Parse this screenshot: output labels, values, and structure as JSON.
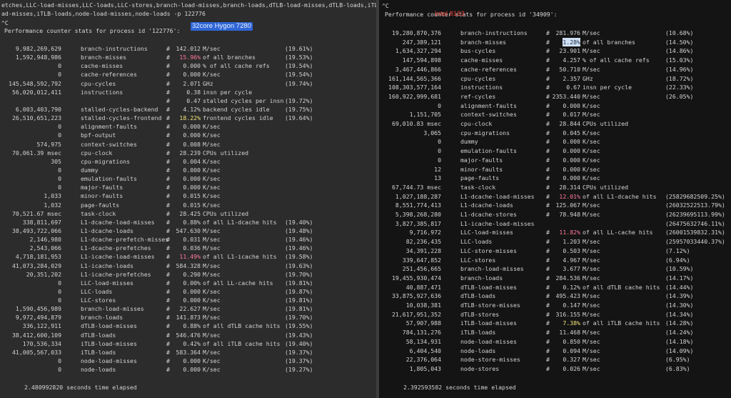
{
  "left": {
    "cmd_lines": [
      "etches,LLC-load-misses,LLC-loads,LLC-stores,branch-load-misses,branch-loads,dTLB-load-misses,dTLB-loads,iTLB-lo",
      "ad-misses,iTLB-loads,node-load-misses,node-loads -p 122776"
    ],
    "interrupt": "^C",
    "header": "Performance counter stats for process id '122776':",
    "badge": "32core Hygon 7280",
    "rows": [
      {
        "value": "9,982,269,629",
        "event": "branch-instructions",
        "hash": "#",
        "metric": "142.012",
        "desc": "M/sec",
        "pct": "(19.61%)"
      },
      {
        "value": "1,592,948,986",
        "event": "branch-misses",
        "hash": "#",
        "metric": "15.96%",
        "desc": "of all branches",
        "pct": "(19.53%)",
        "hl": "red"
      },
      {
        "value": "0",
        "event": "cache-misses",
        "hash": "#",
        "metric": "0.000",
        "desc": "% of all cache refs",
        "pct": "(19.54%)"
      },
      {
        "value": "0",
        "event": "cache-references",
        "hash": "#",
        "metric": "0.000",
        "desc": "K/sec",
        "pct": "(19.54%)"
      },
      {
        "value": "145,548,592,792",
        "event": "cpu-cycles",
        "hash": "#",
        "metric": "2.071",
        "desc": "GHz",
        "pct": "(19.74%)"
      },
      {
        "value": "56,020,012,411",
        "event": "instructions",
        "hash": "#",
        "metric": "0.38",
        "desc": "insn per cycle",
        "pct": ""
      },
      {
        "value": "",
        "event": "",
        "hash": "#",
        "metric": "0.47",
        "desc": "stalled cycles per insn",
        "pct": "(19.72%)"
      },
      {
        "value": "6,003,403,790",
        "event": "stalled-cycles-backend",
        "hash": "#",
        "metric": "4.12%",
        "desc": "backend cycles idle",
        "pct": "(19.75%)"
      },
      {
        "value": "26,510,651,223",
        "event": "stalled-cycles-frontend",
        "hash": "#",
        "metric": "18.22%",
        "desc": "frontend cycles idle",
        "pct": "(19.64%)",
        "hl": "yel"
      },
      {
        "value": "0",
        "event": "alignment-faults",
        "hash": "#",
        "metric": "0.000",
        "desc": "K/sec",
        "pct": ""
      },
      {
        "value": "0",
        "event": "bpf-output",
        "hash": "#",
        "metric": "0.000",
        "desc": "K/sec",
        "pct": ""
      },
      {
        "value": "574,975",
        "event": "context-switches",
        "hash": "#",
        "metric": "0.008",
        "desc": "M/sec",
        "pct": ""
      },
      {
        "value": "70,061.39 msec",
        "event": "cpu-clock",
        "hash": "#",
        "metric": "28.239",
        "desc": "CPUs utilized",
        "pct": ""
      },
      {
        "value": "305",
        "event": "cpu-migrations",
        "hash": "#",
        "metric": "0.004",
        "desc": "K/sec",
        "pct": ""
      },
      {
        "value": "0",
        "event": "dummy",
        "hash": "#",
        "metric": "0.000",
        "desc": "K/sec",
        "pct": ""
      },
      {
        "value": "0",
        "event": "emulation-faults",
        "hash": "#",
        "metric": "0.000",
        "desc": "K/sec",
        "pct": ""
      },
      {
        "value": "0",
        "event": "major-faults",
        "hash": "#",
        "metric": "0.000",
        "desc": "K/sec",
        "pct": ""
      },
      {
        "value": "1,033",
        "event": "minor-faults",
        "hash": "#",
        "metric": "0.015",
        "desc": "K/sec",
        "pct": ""
      },
      {
        "value": "1,032",
        "event": "page-faults",
        "hash": "#",
        "metric": "0.015",
        "desc": "K/sec",
        "pct": ""
      },
      {
        "value": "70,521.67 msec",
        "event": "task-clock",
        "hash": "#",
        "metric": "28.425",
        "desc": "CPUs utilized",
        "pct": ""
      },
      {
        "value": "338,811,697",
        "event": "L1-dcache-load-misses",
        "hash": "#",
        "metric": "0.88%",
        "desc": "of all L1-dcache hits",
        "pct": "(19.40%)"
      },
      {
        "value": "38,493,722,066",
        "event": "L1-dcache-loads",
        "hash": "#",
        "metric": "547.630",
        "desc": "M/sec",
        "pct": "(19.48%)"
      },
      {
        "value": "2,146,980",
        "event": "L1-dcache-prefetch-misses",
        "hash": "#",
        "metric": "0.031",
        "desc": "M/sec",
        "pct": "(19.46%)"
      },
      {
        "value": "2,543,066",
        "event": "L1-dcache-prefetches",
        "hash": "#",
        "metric": "0.036",
        "desc": "M/sec",
        "pct": "(19.46%)"
      },
      {
        "value": "4,718,181,953",
        "event": "L1-icache-load-misses",
        "hash": "#",
        "metric": "11.49%",
        "desc": "of all L1-icache hits",
        "pct": "(19.58%)",
        "hl": "red"
      },
      {
        "value": "41,073,284,029",
        "event": "L1-icache-loads",
        "hash": "#",
        "metric": "584.328",
        "desc": "M/sec",
        "pct": "(19.63%)"
      },
      {
        "value": "20,351,202",
        "event": "L1-icache-prefetches",
        "hash": "#",
        "metric": "0.290",
        "desc": "M/sec",
        "pct": "(19.70%)"
      },
      {
        "value": "0",
        "event": "LLC-load-misses",
        "hash": "#",
        "metric": "0.00%",
        "desc": "of all LL-cache hits",
        "pct": "(19.81%)"
      },
      {
        "value": "0",
        "event": "LLC-loads",
        "hash": "#",
        "metric": "0.000",
        "desc": "K/sec",
        "pct": "(19.87%)"
      },
      {
        "value": "0",
        "event": "LLC-stores",
        "hash": "#",
        "metric": "0.000",
        "desc": "K/sec",
        "pct": "(19.81%)"
      },
      {
        "value": "1,590,456,989",
        "event": "branch-load-misses",
        "hash": "#",
        "metric": "22.627",
        "desc": "M/sec",
        "pct": "(19.81%)"
      },
      {
        "value": "9,972,494,879",
        "event": "branch-loads",
        "hash": "#",
        "metric": "141.873",
        "desc": "M/sec",
        "pct": "(19.70%)"
      },
      {
        "value": "336,122,911",
        "event": "dTLB-load-misses",
        "hash": "#",
        "metric": "0.88%",
        "desc": "of all dTLB cache hits",
        "pct": "(19.55%)"
      },
      {
        "value": "38,412,600,109",
        "event": "dTLB-loads",
        "hash": "#",
        "metric": "546.476",
        "desc": "M/sec",
        "pct": "(19.43%)"
      },
      {
        "value": "170,536,334",
        "event": "iTLB-load-misses",
        "hash": "#",
        "metric": "0.42%",
        "desc": "of all iTLB cache hits",
        "pct": "(19.40%)"
      },
      {
        "value": "41,005,567,033",
        "event": "iTLB-loads",
        "hash": "#",
        "metric": "583.364",
        "desc": "M/sec",
        "pct": "(19.37%)"
      },
      {
        "value": "0",
        "event": "node-load-misses",
        "hash": "#",
        "metric": "0.000",
        "desc": "K/sec",
        "pct": "(19.37%)"
      },
      {
        "value": "0",
        "event": "node-loads",
        "hash": "#",
        "metric": "0.000",
        "desc": "K/sec",
        "pct": "(19.27%)"
      }
    ],
    "elapsed": "2.480992820 seconds time elapsed"
  },
  "right": {
    "interrupt": "^C",
    "header": "Performance counter stats for process id '34909':",
    "badge": "Intel 8163",
    "rows": [
      {
        "value": "19,280,870,376",
        "event": "branch-instructions",
        "hash": "#",
        "metric": "281.976",
        "desc": "M/sec",
        "pct": "(10.68%)"
      },
      {
        "value": "247,389,121",
        "event": "branch-misses",
        "hash": "#",
        "metric": "1.28%",
        "desc": "of all branches",
        "pct": "(14.50%)",
        "hl": "sel"
      },
      {
        "value": "1,634,327,294",
        "event": "bus-cycles",
        "hash": "#",
        "metric": "23.901",
        "desc": "M/sec",
        "pct": "(14.86%)"
      },
      {
        "value": "147,594,898",
        "event": "cache-misses",
        "hash": "#",
        "metric": "4.257",
        "desc": "% of all cache refs",
        "pct": "(15.03%)"
      },
      {
        "value": "3,467,446,866",
        "event": "cache-references",
        "hash": "#",
        "metric": "50.710",
        "desc": "M/sec",
        "pct": "(14.96%)"
      },
      {
        "value": "161,144,565,366",
        "event": "cpu-cycles",
        "hash": "#",
        "metric": "2.357",
        "desc": "GHz",
        "pct": "(18.72%)"
      },
      {
        "value": "108,303,577,164",
        "event": "instructions",
        "hash": "#",
        "metric": "0.67",
        "desc": "insn per cycle",
        "pct": "(22.33%)"
      },
      {
        "value": "160,922,999,681",
        "event": "ref-cycles",
        "hash": "#",
        "metric": "2353.440",
        "desc": "M/sec",
        "pct": "(26.05%)"
      },
      {
        "value": "0",
        "event": "alignment-faults",
        "hash": "#",
        "metric": "0.000",
        "desc": "K/sec",
        "pct": ""
      },
      {
        "value": "1,151,705",
        "event": "context-switches",
        "hash": "#",
        "metric": "0.017",
        "desc": "M/sec",
        "pct": ""
      },
      {
        "value": "69,010.83 msec",
        "event": "cpu-clock",
        "hash": "#",
        "metric": "28.844",
        "desc": "CPUs utilized",
        "pct": ""
      },
      {
        "value": "3,065",
        "event": "cpu-migrations",
        "hash": "#",
        "metric": "0.045",
        "desc": "K/sec",
        "pct": ""
      },
      {
        "value": "0",
        "event": "dummy",
        "hash": "#",
        "metric": "0.000",
        "desc": "K/sec",
        "pct": ""
      },
      {
        "value": "0",
        "event": "emulation-faults",
        "hash": "#",
        "metric": "0.000",
        "desc": "K/sec",
        "pct": ""
      },
      {
        "value": "0",
        "event": "major-faults",
        "hash": "#",
        "metric": "0.000",
        "desc": "K/sec",
        "pct": ""
      },
      {
        "value": "12",
        "event": "minor-faults",
        "hash": "#",
        "metric": "0.000",
        "desc": "K/sec",
        "pct": ""
      },
      {
        "value": "13",
        "event": "page-faults",
        "hash": "#",
        "metric": "0.000",
        "desc": "K/sec",
        "pct": ""
      },
      {
        "value": "67,744.73 msec",
        "event": "task-clock",
        "hash": "#",
        "metric": "28.314",
        "desc": "CPUs utilized",
        "pct": ""
      },
      {
        "value": "1,027,188,287",
        "event": "L1-dcache-load-misses",
        "hash": "#",
        "metric": "12.01%",
        "desc": "of all L1-dcache hits",
        "pct": "(25829682509.25%)",
        "hl": "red"
      },
      {
        "value": "8,551,774,413",
        "event": "L1-dcache-loads",
        "hash": "#",
        "metric": "125.067",
        "desc": "M/sec",
        "pct": "(26032522513.79%)"
      },
      {
        "value": "5,398,268,280",
        "event": "L1-dcache-stores",
        "hash": "#",
        "metric": "78.948",
        "desc": "M/sec",
        "pct": "(26239695113.99%)"
      },
      {
        "value": "3,827,385,817",
        "event": "L1-icache-load-misses",
        "hash": "",
        "metric": "",
        "desc": "",
        "pct": "(26475632746.11%)"
      },
      {
        "value": "9,716,972",
        "event": "LLC-load-misses",
        "hash": "#",
        "metric": "11.82%",
        "desc": "of all LL-cache hits",
        "pct": "(26001539832.31%)",
        "hl": "red"
      },
      {
        "value": "82,236,435",
        "event": "LLC-loads",
        "hash": "#",
        "metric": "1.203",
        "desc": "M/sec",
        "pct": "(25957033440.37%)"
      },
      {
        "value": "34,391,228",
        "event": "LLC-store-misses",
        "hash": "#",
        "metric": "0.503",
        "desc": "M/sec",
        "pct": "(7.12%)"
      },
      {
        "value": "339,647,852",
        "event": "LLC-stores",
        "hash": "#",
        "metric": "4.967",
        "desc": "M/sec",
        "pct": "(6.94%)"
      },
      {
        "value": "251,456,665",
        "event": "branch-load-misses",
        "hash": "#",
        "metric": "3.677",
        "desc": "M/sec",
        "pct": "(10.59%)"
      },
      {
        "value": "19,455,930,474",
        "event": "branch-loads",
        "hash": "#",
        "metric": "284.536",
        "desc": "M/sec",
        "pct": "(14.17%)"
      },
      {
        "value": "40,887,471",
        "event": "dTLB-load-misses",
        "hash": "#",
        "metric": "0.12%",
        "desc": "of all dTLB cache hits",
        "pct": "(14.44%)"
      },
      {
        "value": "33,875,927,636",
        "event": "dTLB-loads",
        "hash": "#",
        "metric": "495.423",
        "desc": "M/sec",
        "pct": "(14.39%)"
      },
      {
        "value": "10,038,381",
        "event": "dTLB-store-misses",
        "hash": "#",
        "metric": "0.147",
        "desc": "M/sec",
        "pct": "(14.30%)"
      },
      {
        "value": "21,617,951,352",
        "event": "dTLB-stores",
        "hash": "#",
        "metric": "316.155",
        "desc": "M/sec",
        "pct": "(14.34%)"
      },
      {
        "value": "57,907,988",
        "event": "iTLB-load-misses",
        "hash": "#",
        "metric": "7.38%",
        "desc": "of all iTLB cache hits",
        "pct": "(14.28%)",
        "hl": "yel"
      },
      {
        "value": "784,131,276",
        "event": "iTLB-loads",
        "hash": "#",
        "metric": "11.468",
        "desc": "M/sec",
        "pct": "(14.24%)"
      },
      {
        "value": "58,134,931",
        "event": "node-load-misses",
        "hash": "#",
        "metric": "0.850",
        "desc": "M/sec",
        "pct": "(14.18%)"
      },
      {
        "value": "6,404,540",
        "event": "node-loads",
        "hash": "#",
        "metric": "0.094",
        "desc": "M/sec",
        "pct": "(14.09%)"
      },
      {
        "value": "22,376,064",
        "event": "node-store-misses",
        "hash": "#",
        "metric": "0.327",
        "desc": "M/sec",
        "pct": "(6.95%)"
      },
      {
        "value": "1,805,043",
        "event": "node-stores",
        "hash": "#",
        "metric": "0.026",
        "desc": "M/sec",
        "pct": "(6.83%)"
      }
    ],
    "elapsed": "2.392593582 seconds time elapsed"
  },
  "colors": {
    "left_bg": "#2c2c2c",
    "right_bg": "#141414",
    "red": "#ff7a9c",
    "yellow": "#f2e47a",
    "intel": "#e8403a",
    "hygon_bg": "#2f66d6"
  }
}
